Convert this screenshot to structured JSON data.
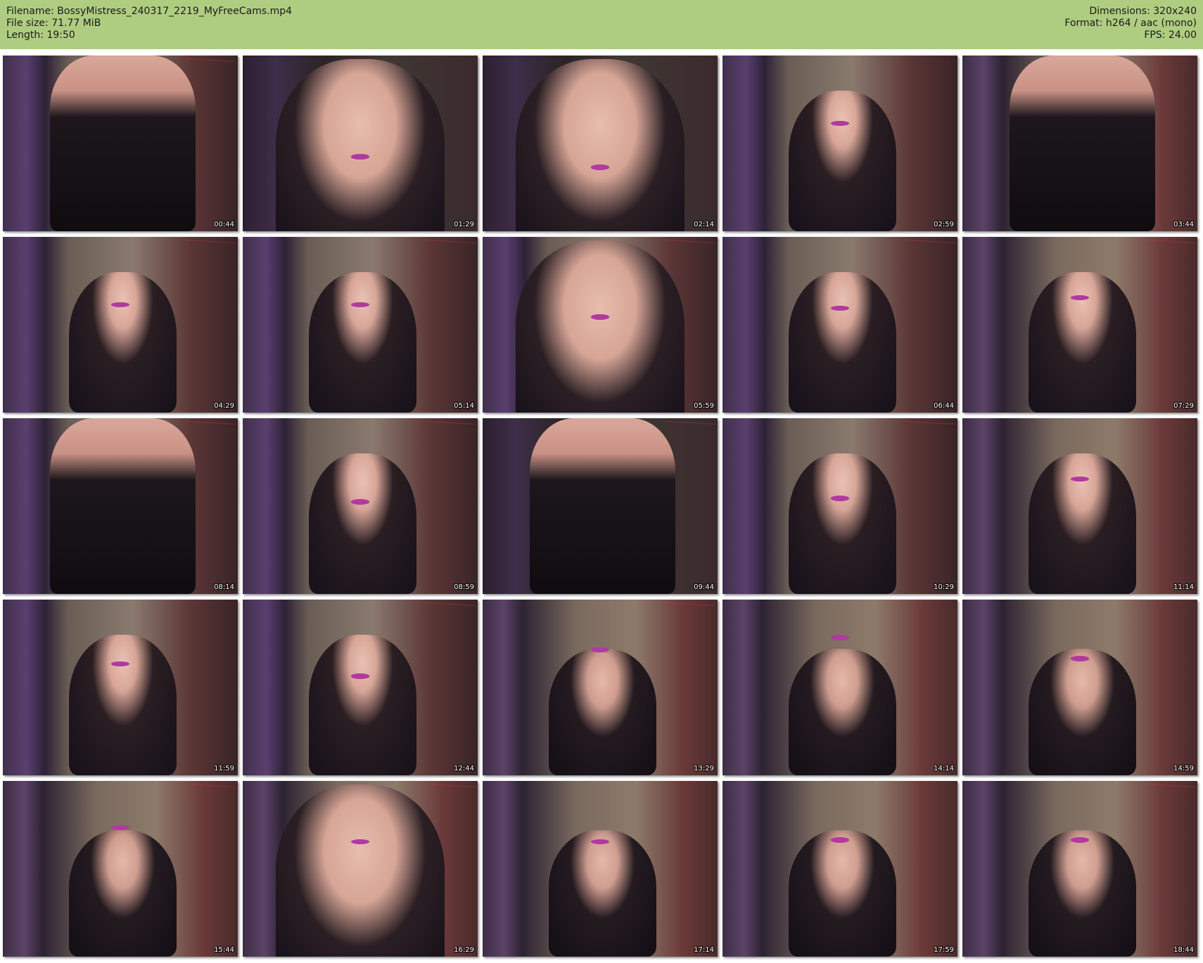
{
  "header": {
    "filename_line": "Filename: BossyMistress_240317_2219_MyFreeCams.mp4",
    "filesize_line": "File size: 71.77 MiB",
    "length_line": "Length: 19:50",
    "dimensions_line": "Dimensions: 320x240",
    "format_line": "Format: h264 / aac (mono)",
    "fps_line": "FPS: 24.00"
  },
  "colors": {
    "header_bg": "#afcd80",
    "page_bg": "#ffffff"
  },
  "thumbnails": [
    {
      "time": "00:44"
    },
    {
      "time": "01:29"
    },
    {
      "time": "02:14"
    },
    {
      "time": "02:59"
    },
    {
      "time": "03:44"
    },
    {
      "time": "04:29"
    },
    {
      "time": "05:14"
    },
    {
      "time": "05:59"
    },
    {
      "time": "06:44"
    },
    {
      "time": "07:29"
    },
    {
      "time": "08:14"
    },
    {
      "time": "08:59"
    },
    {
      "time": "09:44"
    },
    {
      "time": "10:29"
    },
    {
      "time": "11:14"
    },
    {
      "time": "11:59"
    },
    {
      "time": "12:44"
    },
    {
      "time": "13:29"
    },
    {
      "time": "14:14"
    },
    {
      "time": "14:59"
    },
    {
      "time": "15:44"
    },
    {
      "time": "16:29"
    },
    {
      "time": "17:14"
    },
    {
      "time": "17:59"
    },
    {
      "time": "18:44"
    }
  ]
}
